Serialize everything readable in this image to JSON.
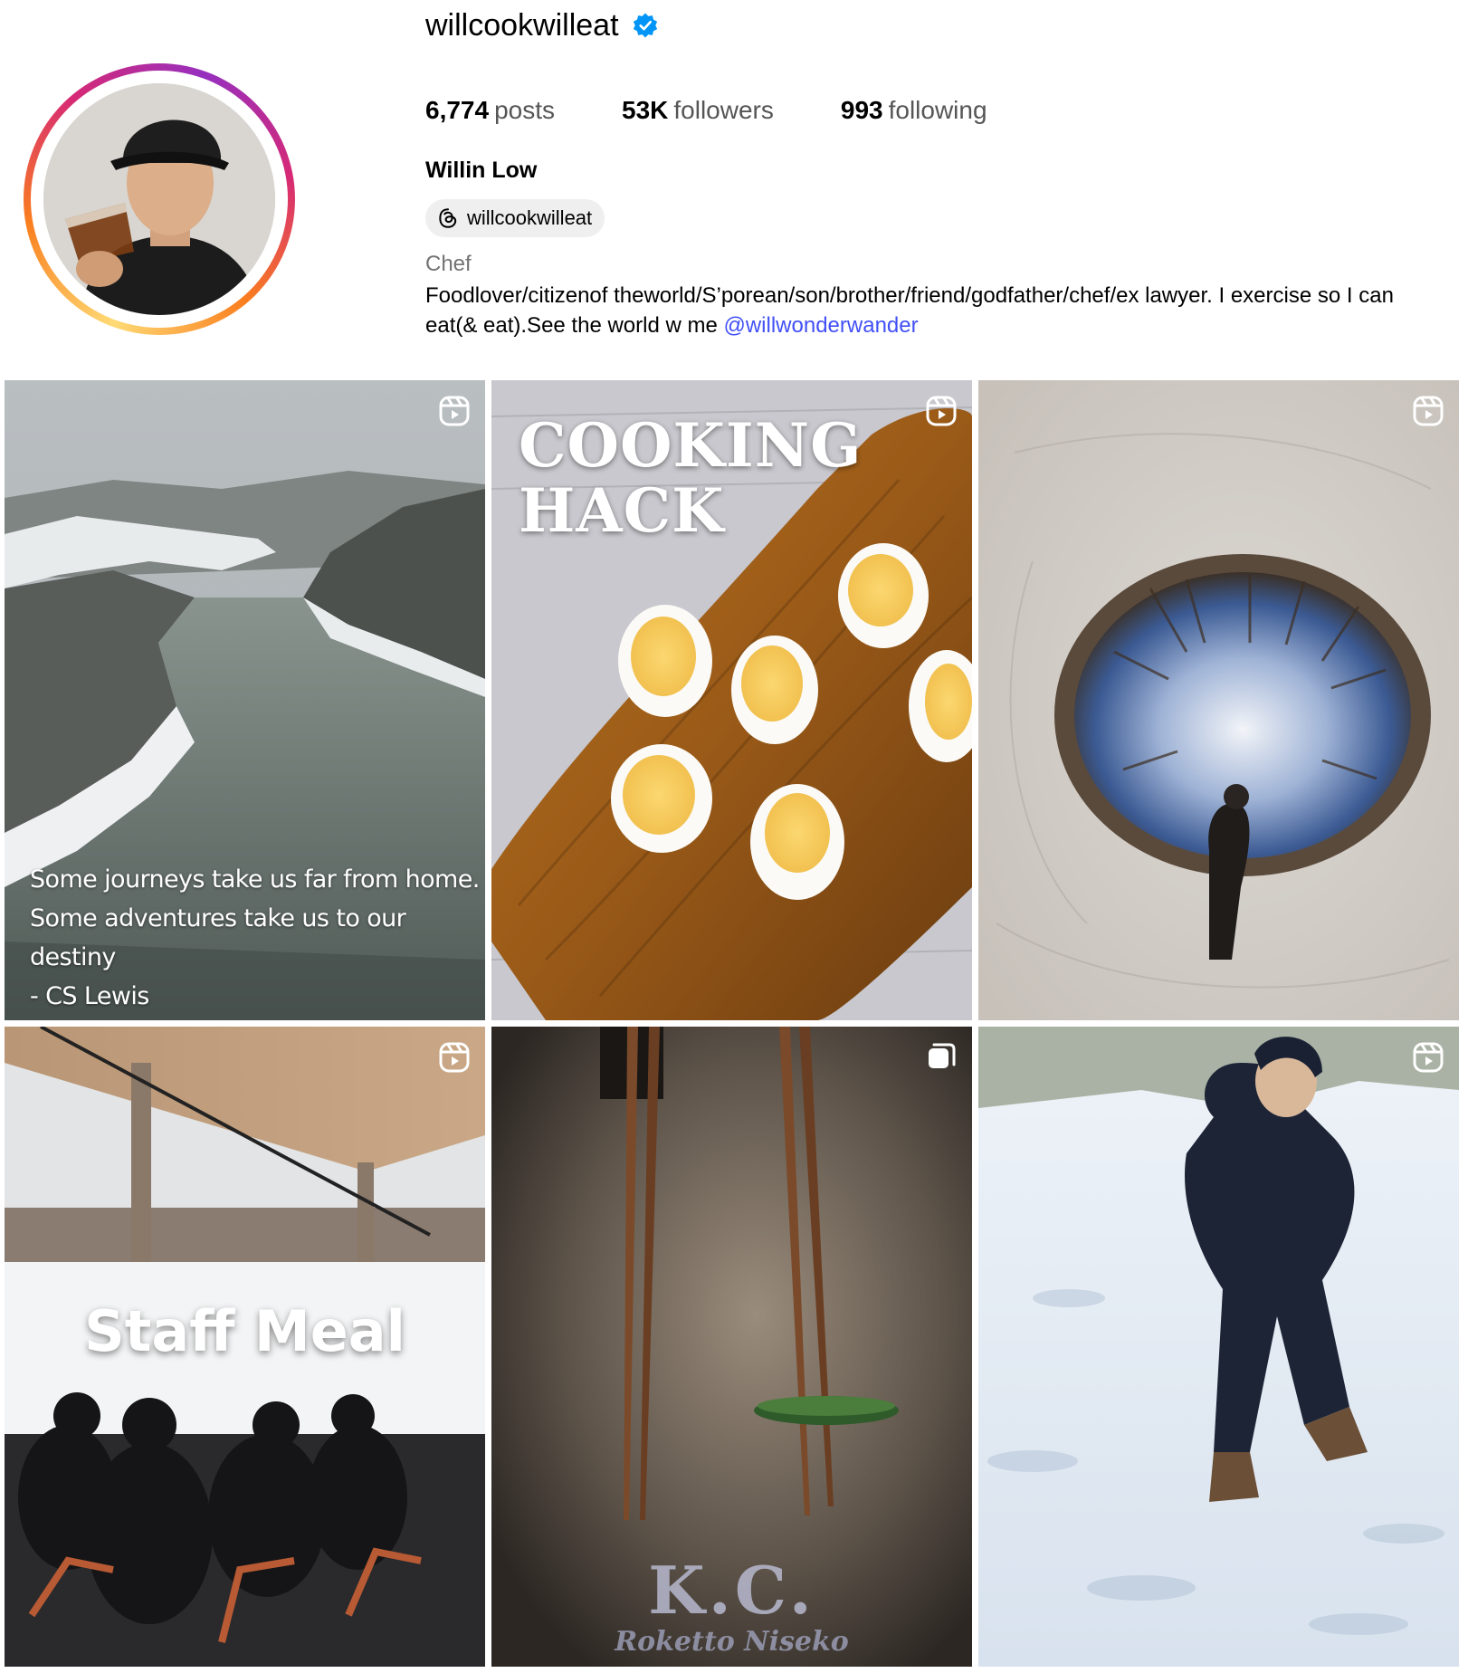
{
  "profile": {
    "username": "willcookwilleat",
    "verified": true,
    "stats": {
      "posts_count": "6,774",
      "posts_label": "posts",
      "followers_count": "53K",
      "followers_label": "followers",
      "following_count": "993",
      "following_label": "following"
    },
    "full_name": "Willin Low",
    "threads_handle": "willcookwilleat",
    "category": "Chef",
    "bio_text": "Foodlover/citizenof theworld/S’porean/son/brother/friend/godfather/chef/ex lawyer. I exercise so I can eat(& eat).See the world w me ",
    "bio_mention": "@willwonderwander"
  },
  "posts": [
    {
      "type": "reel",
      "icon": "reel-icon",
      "overlay_text": "Some journeys take us far from home.\nSome adventures take us to our destiny\n- CS Lewis"
    },
    {
      "type": "reel",
      "icon": "reel-icon",
      "overlay_text": "COOKING\nHACK"
    },
    {
      "type": "reel",
      "icon": "reel-icon",
      "overlay_text": ""
    },
    {
      "type": "reel",
      "icon": "reel-icon",
      "overlay_text": "Staff Meal"
    },
    {
      "type": "carousel",
      "icon": "carousel-icon",
      "overlay_text": "K.C.",
      "overlay_subtext": "Roketto Niseko"
    },
    {
      "type": "reel",
      "icon": "reel-icon",
      "overlay_text": ""
    }
  ],
  "colors": {
    "verified_badge": "#0095f6",
    "mention_link": "#4150f7",
    "pill_background": "#efefef",
    "muted_text": "#737373"
  }
}
